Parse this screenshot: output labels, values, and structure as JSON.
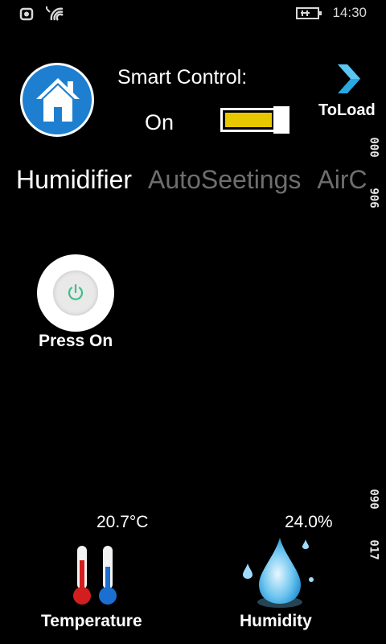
{
  "status_bar": {
    "time": "14:30"
  },
  "header": {
    "smart_control_label": "Smart Control:",
    "smart_control_state": "On",
    "toggle_on": true,
    "toggle_color": "#e6c700",
    "to_load_label": "ToLoad",
    "side_numbers": [
      "000",
      "906",
      "090",
      "017"
    ]
  },
  "tabs": [
    "Humidifier",
    "AutoSeetings",
    "AirC"
  ],
  "power": {
    "label": "Press On",
    "icon": "power-icon",
    "icon_color": "#3cc08a"
  },
  "sensors": {
    "temperature": {
      "value": "20.7°C",
      "label": "Temperature"
    },
    "humidity": {
      "value": "24.0%",
      "label": "Humidity"
    }
  },
  "colors": {
    "home_button": "#1e7fd0",
    "accent_arrow": "#2aa8e0"
  }
}
